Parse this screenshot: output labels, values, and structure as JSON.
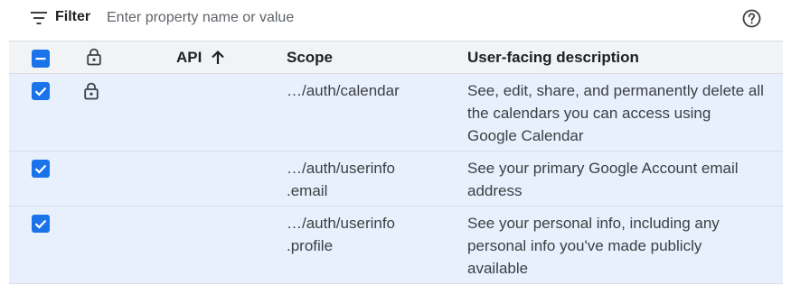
{
  "filter": {
    "label": "Filter",
    "placeholder": "Enter property name or value",
    "value": ""
  },
  "table": {
    "columns": {
      "api": "API",
      "scope": "Scope",
      "description": "User-facing description"
    },
    "sort": {
      "column": "API",
      "direction": "ascending"
    },
    "rows": [
      {
        "checked": true,
        "locked": true,
        "scope_lines": [
          "…/auth/calendar"
        ],
        "description_lines": [
          "See, edit, share, and permanently delete all",
          "the calendars you can access using",
          "Google Calendar"
        ]
      },
      {
        "checked": true,
        "locked": false,
        "scope_lines": [
          "…/auth/userinfo",
          ".email"
        ],
        "description_lines": [
          "See your primary Google Account email",
          "address"
        ]
      },
      {
        "checked": true,
        "locked": false,
        "scope_lines": [
          "…/auth/userinfo",
          ".profile"
        ],
        "description_lines": [
          "See your personal info, including any",
          "personal info you've made publicly",
          "available"
        ]
      }
    ]
  },
  "colors": {
    "accent": "#1a73e8",
    "selected_row": "#e8f0fe",
    "header_bg": "#f1f3f4",
    "divider": "#dadce0"
  },
  "icons": {
    "filter": "filter-icon",
    "help": "help-circle-icon",
    "lock": "lock-icon",
    "sort": "arrow-up-icon"
  }
}
